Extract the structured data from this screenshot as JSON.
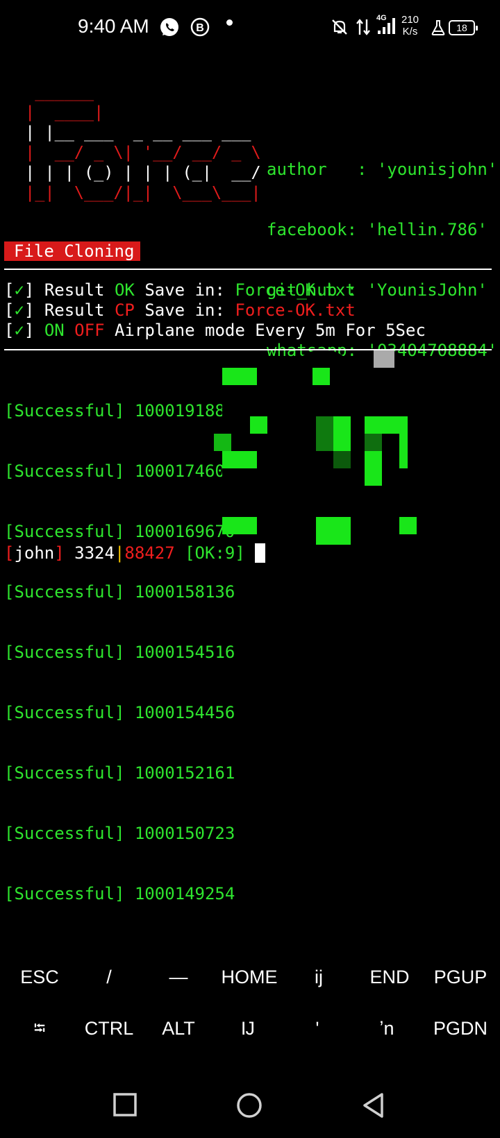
{
  "status_bar": {
    "time": "9:40 AM",
    "network_type": "4G",
    "speed_value": "210",
    "speed_unit": "K/s",
    "battery": "18",
    "icons": [
      "whatsapp-icon",
      "b-circle-icon",
      "dot-icon",
      "bell-off-icon",
      "data-arrows-icon",
      "signal-icon",
      "lab-flask-icon",
      "battery-icon"
    ]
  },
  "terminal": {
    "logo_lines": [
      {
        "type": "art",
        "text": "Force"
      }
    ],
    "info": {
      "author": "author   : 'younisjohn'",
      "facebook": "facebook: 'hellin.786'",
      "git_hub": "git_hub : 'YounisJohn'",
      "whatsapp": "whatsapp: '03404708884'"
    },
    "banner": "File Cloning",
    "notes": [
      {
        "check": "✓",
        "prefix": "Result ",
        "tag": "OK",
        "middle": " Save in: ",
        "file": "Force-OK.txt"
      },
      {
        "check": "✓",
        "prefix": "Result ",
        "tag": "CP",
        "middle": " Save in: ",
        "file": "Force-OK.txt"
      },
      {
        "check": "✓",
        "on": "ON",
        "off": "OFF",
        "rest": " Airplane mode Every 5m For 5Sec"
      }
    ],
    "results": [
      "[Successful] 1000191883",
      "[Successful] 1000174609",
      "[Successful] 1000169670",
      "[Successful] 1000158136",
      "[Successful] 1000154516",
      "[Successful] 1000154456",
      "[Successful] 1000152161",
      "[Successful] 1000150723",
      "[Successful] 1000149254"
    ],
    "prompt": {
      "user": "john",
      "count": "3324",
      "total": "88427",
      "ok": "[OK:9]"
    }
  },
  "extra_keys": {
    "row1": [
      "ESC",
      "/",
      "—",
      "HOME",
      "ij",
      "END",
      "PGUP"
    ],
    "row2": [
      "⭾",
      "CTRL",
      "ALT",
      "Ĳ",
      "ʹ",
      "ʼn",
      "PGDN"
    ]
  },
  "nav": [
    "recents-square-icon",
    "home-circle-icon",
    "back-triangle-icon"
  ],
  "colors": {
    "green": "#2ee52e",
    "red": "#e01b1b",
    "yellow": "#f2c200",
    "background": "#000000"
  }
}
